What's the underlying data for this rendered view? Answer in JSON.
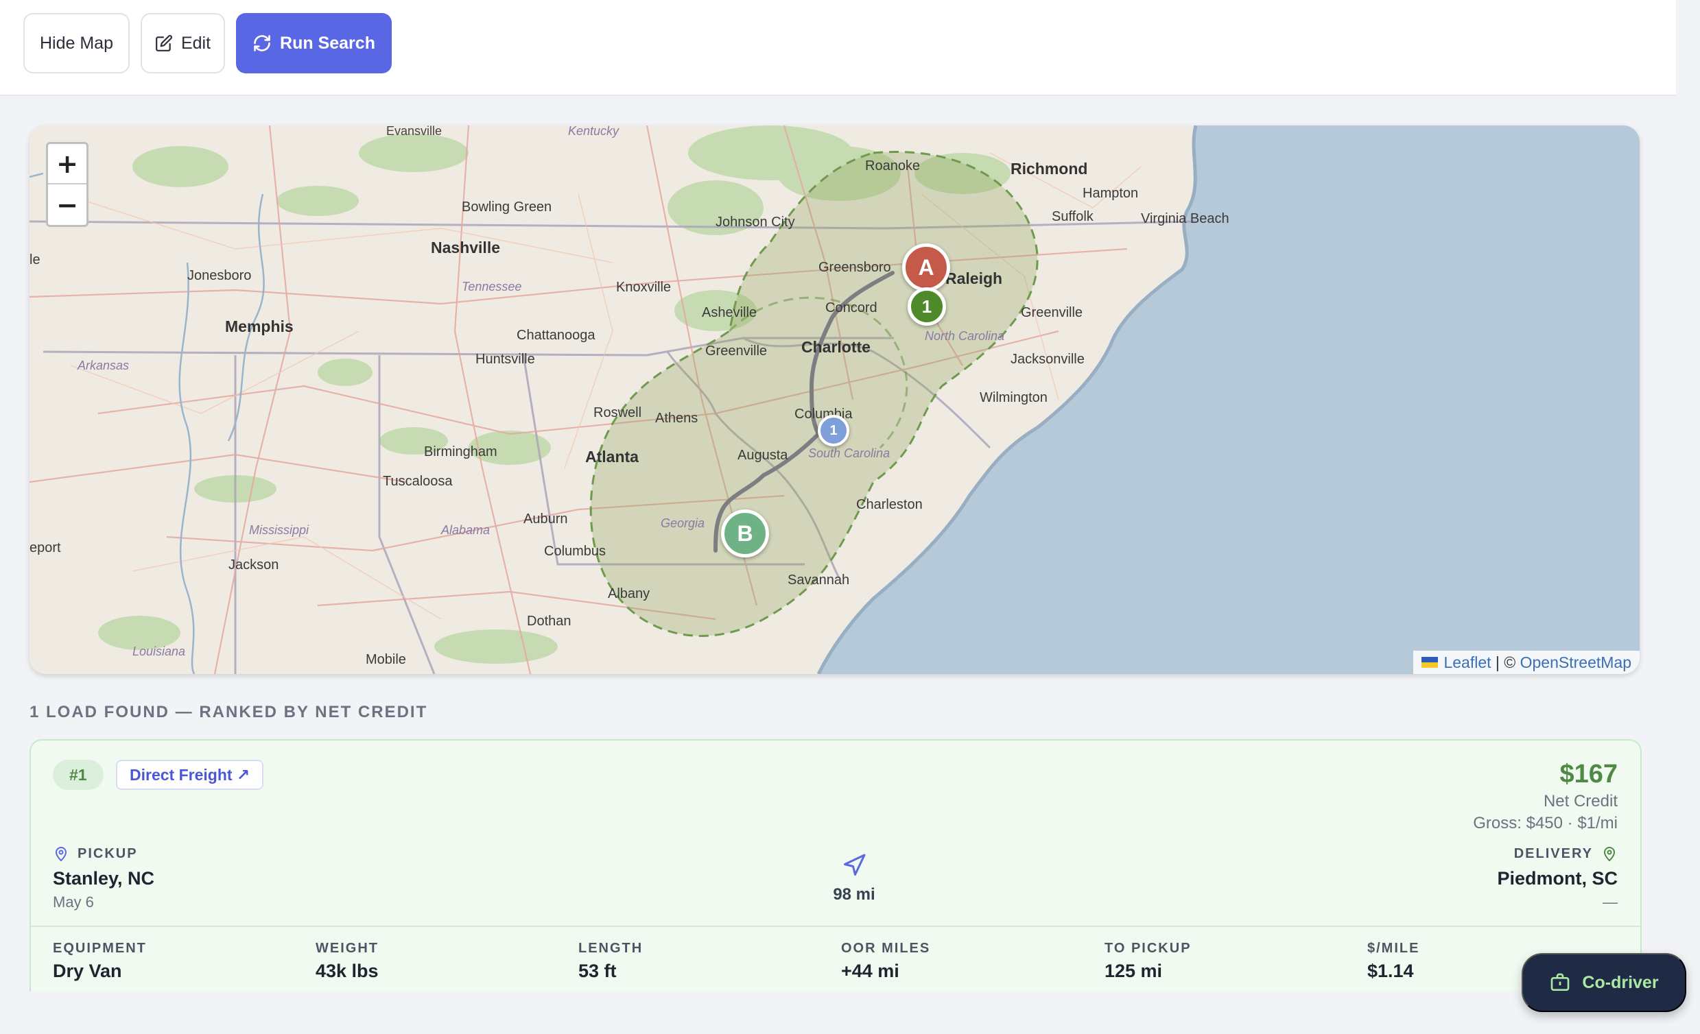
{
  "toolbar": {
    "hide_map_label": "Hide Map",
    "edit_label": "Edit",
    "run_search_label": "Run Search"
  },
  "map": {
    "zoom_in": "+",
    "zoom_out": "−",
    "attribution_leaflet": "Leaflet",
    "attribution_sep": " | © ",
    "attribution_osm": "OpenStreetMap",
    "labels": {
      "evansville": "Evansville",
      "kentucky": "Kentucky",
      "roanoke": "Roanoke",
      "richmond": "Richmond",
      "bowling_green": "Bowling Green",
      "johnson_city": "Johnson City",
      "hampton": "Hampton",
      "suffolk": "Suffolk",
      "virginia_beach": "Virginia Beach",
      "nashville": "Nashville",
      "greensboro": "Greensboro",
      "raleigh": "Raleigh",
      "jonesboro": "Jonesboro",
      "tennessee": "Tennessee",
      "knoxville": "Knoxville",
      "asheville": "Asheville",
      "concord": "Concord",
      "greenville_nc": "Greenville",
      "memphis": "Memphis",
      "chattanooga": "Chattanooga",
      "charlotte": "Charlotte",
      "north_carolina": "North Carolina",
      "greenville_sc": "Greenville",
      "huntsville": "Huntsville",
      "jacksonville": "Jacksonville",
      "arkansas": "Arkansas",
      "roswell": "Roswell",
      "athens": "Athens",
      "columbia": "Columbia",
      "wilmington": "Wilmington",
      "birmingham": "Birmingham",
      "atlanta": "Atlanta",
      "augusta": "Augusta",
      "south_carolina": "South Carolina",
      "tuscaloosa": "Tuscaloosa",
      "charleston": "Charleston",
      "auburn": "Auburn",
      "georgia": "Georgia",
      "mississippi": "Mississippi",
      "alabama": "Alabama",
      "columbus": "Columbus",
      "eport": "eport",
      "jackson": "Jackson",
      "savannah": "Savannah",
      "albany": "Albany",
      "dothan": "Dothan",
      "louisiana": "Louisiana",
      "mobile": "Mobile",
      "le": "le"
    },
    "markers": {
      "origin": "A",
      "destination": "B",
      "pickup_pin": "1",
      "route_pin": "1"
    }
  },
  "results": {
    "heading": "1 LOAD FOUND — RANKED BY NET CREDIT"
  },
  "load": {
    "rank": "#1",
    "broker": "Direct Freight ↗",
    "net_amount": "$167",
    "net_label": "Net Credit",
    "gross": "Gross: $450 · $1/mi",
    "pickup_caption": "PICKUP",
    "pickup_city": "Stanley, NC",
    "pickup_date": "May 6",
    "distance": "98 mi",
    "delivery_caption": "DELIVERY",
    "delivery_city": "Piedmont, SC",
    "delivery_date": "—",
    "stats": [
      {
        "label": "EQUIPMENT",
        "value": "Dry Van"
      },
      {
        "label": "WEIGHT",
        "value": "43k lbs"
      },
      {
        "label": "LENGTH",
        "value": "53 ft"
      },
      {
        "label": "OOR MILES",
        "value": "+44 mi"
      },
      {
        "label": "TO PICKUP",
        "value": "125 mi"
      },
      {
        "label": "$/MILE",
        "value": "$1.14"
      }
    ]
  },
  "codriver": {
    "label": "Co-driver"
  },
  "colors": {
    "primary": "#5a67e5",
    "success": "#4e8a43",
    "origin_marker": "#c65a4a",
    "destination_marker": "#6fb285",
    "pickup_marker": "#4f8a2a",
    "route_marker": "#7f9fd9",
    "codriver_bg": "#1f2a44"
  }
}
